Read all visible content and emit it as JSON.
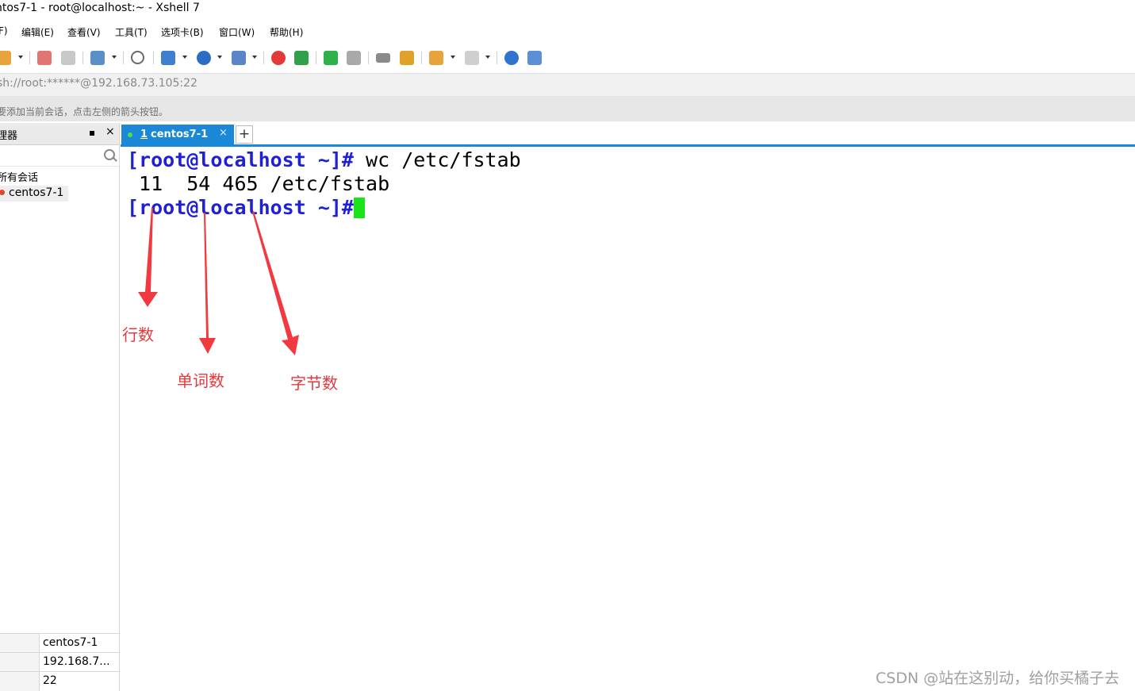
{
  "window": {
    "title": "ntos7-1 - root@localhost:~ - Xshell 7"
  },
  "menu": [
    "F)",
    "编辑(E)",
    "查看(V)",
    "工具(T)",
    "选项卡(B)",
    "窗口(W)",
    "帮助(H)"
  ],
  "address": "sh://root:******@192.168.73.105:22",
  "hint": "要添加当前会话，点击左侧的箭头按钮。",
  "sidebar": {
    "title": "理器",
    "pin": "▪",
    "close": "×",
    "root_label": "所有会话",
    "session": "centos7-1",
    "props": [
      "centos7-1",
      "192.168.7...",
      "22"
    ]
  },
  "tabs": [
    {
      "number": "1",
      "label": "centos7-1",
      "close": "×"
    }
  ],
  "add_tab": "+",
  "terminal": {
    "line1_prompt": "[root@localhost ~]#",
    "line1_cmd": " wc /etc/fstab",
    "line2": " 11  54 465 /etc/fstab",
    "line3_prompt": "[root@localhost ~]#"
  },
  "annotations": {
    "lines": "行数",
    "words": "单词数",
    "bytes": "字节数"
  },
  "watermark": "CSDN @站在这别动，给你买橘子去",
  "colors": {
    "tab_active": "#1a88d6",
    "prompt": "#1f1fd6",
    "cursor": "#19e319",
    "annotation": "#e8383d"
  }
}
